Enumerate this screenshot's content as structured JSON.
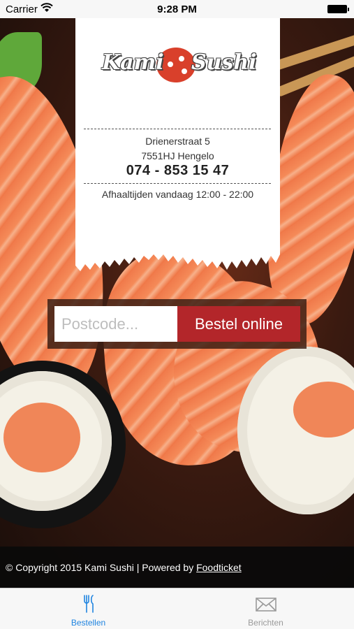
{
  "status_bar": {
    "carrier": "Carrier",
    "time": "9:28 PM"
  },
  "restaurant": {
    "logo_text_a": "Kami",
    "logo_text_b": "Sushi",
    "street": "Drienerstraat 5",
    "city": "7551HJ Hengelo",
    "phone": "074 - 853 15 47",
    "hours": "Afhaaltijden vandaag 12:00 - 22:00"
  },
  "order": {
    "postcode_placeholder": "Postcode...",
    "postcode_value": "",
    "order_button_label": "Bestel online"
  },
  "footer": {
    "copyright": "© Copyright 2015 Kami Sushi | Powered by",
    "powered_by_link": "Foodticket"
  },
  "tabs": [
    {
      "label": "Bestellen",
      "icon": "fork-knife-icon",
      "active": true
    },
    {
      "label": "Berichten",
      "icon": "envelope-icon",
      "active": false
    }
  ],
  "colors": {
    "accent": "#b3262a",
    "tab_active": "#1f84e0",
    "tab_inactive": "#9a9a9a"
  }
}
